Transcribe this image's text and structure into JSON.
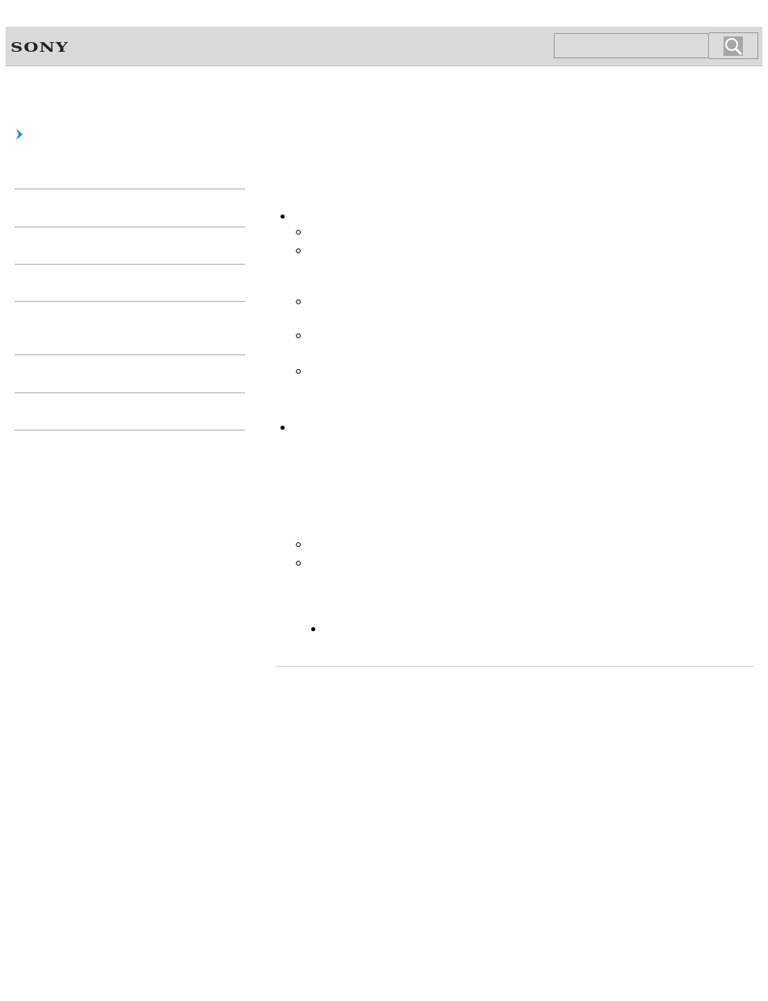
{
  "header": {
    "logo": "SONY"
  },
  "content": {
    "bullets": [
      {
        "kind": "disc",
        "children": [
          {
            "kind": "circle"
          },
          {
            "kind": "circle"
          },
          {
            "kind": "circle"
          },
          {
            "kind": "circle"
          },
          {
            "kind": "circle"
          }
        ]
      },
      {
        "kind": "disc",
        "children": [
          {
            "kind": "circle"
          },
          {
            "kind": "circle",
            "children": [
              {
                "kind": "disc"
              }
            ]
          }
        ]
      }
    ]
  }
}
